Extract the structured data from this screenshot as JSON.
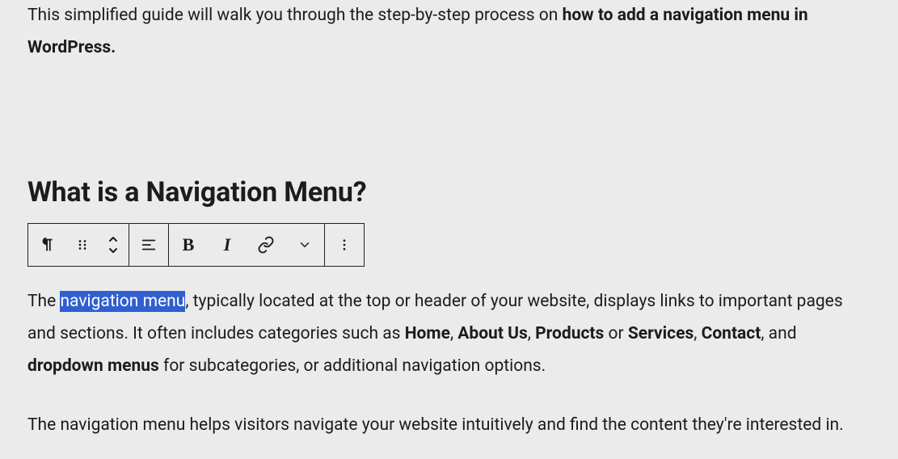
{
  "intro": {
    "prefix": "This simplified guide will walk you through the step-by-step process on ",
    "bold": "how to add a navigation menu in WordPress.",
    "suffix": ""
  },
  "heading": "What is a Navigation Menu?",
  "toolbar": {
    "group1": {
      "block_type": "paragraph",
      "drag": "drag",
      "move": "move"
    },
    "group2": {
      "align": "align"
    },
    "group3": {
      "bold": "B",
      "italic": "I",
      "link": "link",
      "more_formatting": "more"
    },
    "group4": {
      "options": "options"
    }
  },
  "body1": {
    "t1": "The ",
    "sel": "navigation menu",
    "t2": ", typically located at the top or header of your website, displays links to important pages and sections. It often includes categories such as ",
    "s1": "Home",
    "c1": ", ",
    "s2": "About Us",
    "c2": ", ",
    "s3": "Products",
    "c3": " or ",
    "s4": "Services",
    "c4": ", ",
    "s5": "Contact",
    "c5": ", and ",
    "s6": "dropdown menus",
    "t3": " for subcategories, or additional navigation options."
  },
  "body2": "The navigation menu helps visitors navigate your website intuitively and find the content they're interested in."
}
